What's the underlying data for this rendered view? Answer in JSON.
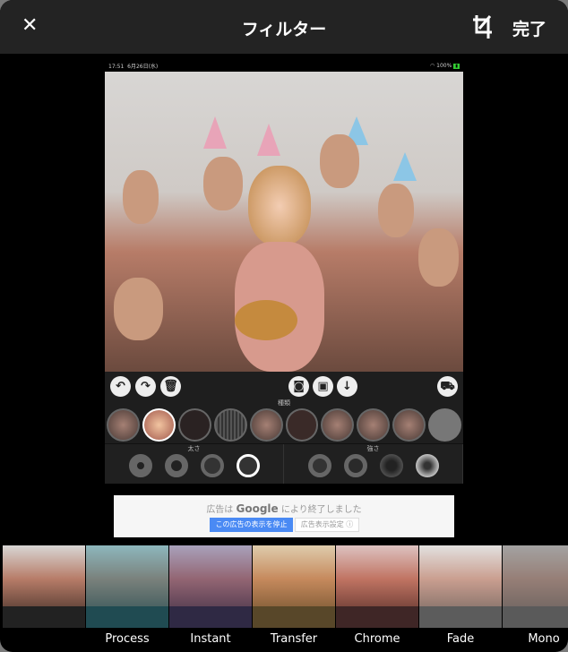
{
  "header": {
    "close_icon": "close-icon",
    "title": "フィルター",
    "crop_icon": "crop-icon",
    "done_label": "完了"
  },
  "screenshot": {
    "status": {
      "time": "17:51",
      "date": "6月26日(水)",
      "battery": "100%"
    },
    "toolbar": {
      "left": [
        "undo-icon",
        "redo-icon",
        "trash-icon"
      ],
      "center": [
        "camera-icon",
        "gallery-icon",
        "download-icon"
      ],
      "right": "cart-icon"
    },
    "kinds_label": "種類",
    "thickness_label": "太さ",
    "strength_label": "強さ"
  },
  "ad": {
    "text_prefix": "広告は",
    "brand": "Google",
    "text_suffix": "により終了しました",
    "stop_button": "この広告の表示を停止",
    "settings_button": "広告表示設定 ⓘ"
  },
  "filters": [
    {
      "label": "",
      "tint": "#ffffff00"
    },
    {
      "label": "Process",
      "tint": "#1f8a9a66"
    },
    {
      "label": "Instant",
      "tint": "#4a3a8a55"
    },
    {
      "label": "Transfer",
      "tint": "#f0b04044"
    },
    {
      "label": "Chrome",
      "tint": "#ff404022"
    },
    {
      "label": "Fade",
      "tint": "#ffffff44"
    },
    {
      "label": "Mono",
      "tint": "#80808099"
    }
  ]
}
